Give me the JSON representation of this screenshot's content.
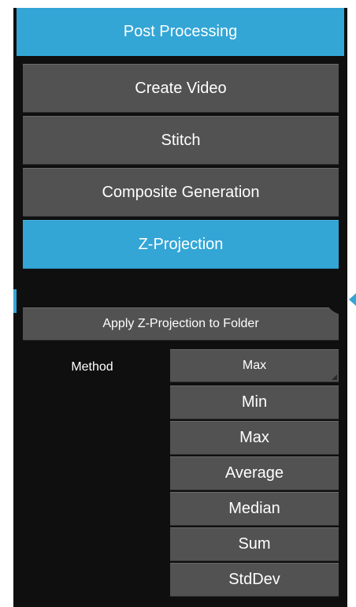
{
  "header": {
    "title": "Post Processing"
  },
  "menu": [
    {
      "label": "Create Video"
    },
    {
      "label": "Stitch"
    },
    {
      "label": "Composite Generation"
    },
    {
      "label": "Z-Projection"
    }
  ],
  "z_projection": {
    "apply_label": "Apply Z-Projection to Folder",
    "method_label": "Method",
    "method_selected": "Max",
    "method_options": [
      "Min",
      "Max",
      "Average",
      "Median",
      "Sum",
      "StdDev"
    ]
  },
  "colors": {
    "accent": "#33a6d6",
    "button": "#525252",
    "panel": "#0f0f0f"
  }
}
